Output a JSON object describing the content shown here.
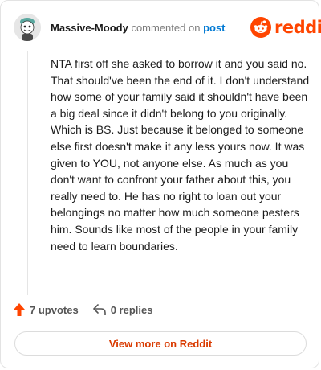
{
  "comment": {
    "username": "Massive-Moody",
    "action_text": "commented on",
    "post_link": "post",
    "body": "NTA first off she asked to borrow it and you said no. That should've been the end of it. I don't understand how some of your family said it shouldn't have been a big deal since it didn't belong to you originally. Which is BS. Just because it belonged to someone else first doesn't make it any less yours now. It was given to YOU, not anyone else. As much as you don't want to confront your father about this, you really need to. He has no right to loan out your belongings no matter how much someone pesters him. Sounds like most of the people in your family need to learn boundaries.",
    "upvotes_label": "7 upvotes",
    "replies_label": "0 replies"
  },
  "brand": {
    "logo_text": "reddit",
    "accent": "#ff4500",
    "link_color": "#0079d3"
  },
  "footer": {
    "view_more_label": "View more on Reddit"
  },
  "icons": {
    "avatar": "snoo-avatar-icon",
    "logo": "reddit-logo-icon",
    "upvote": "upvote-arrow-icon",
    "reply": "reply-arrow-icon"
  }
}
